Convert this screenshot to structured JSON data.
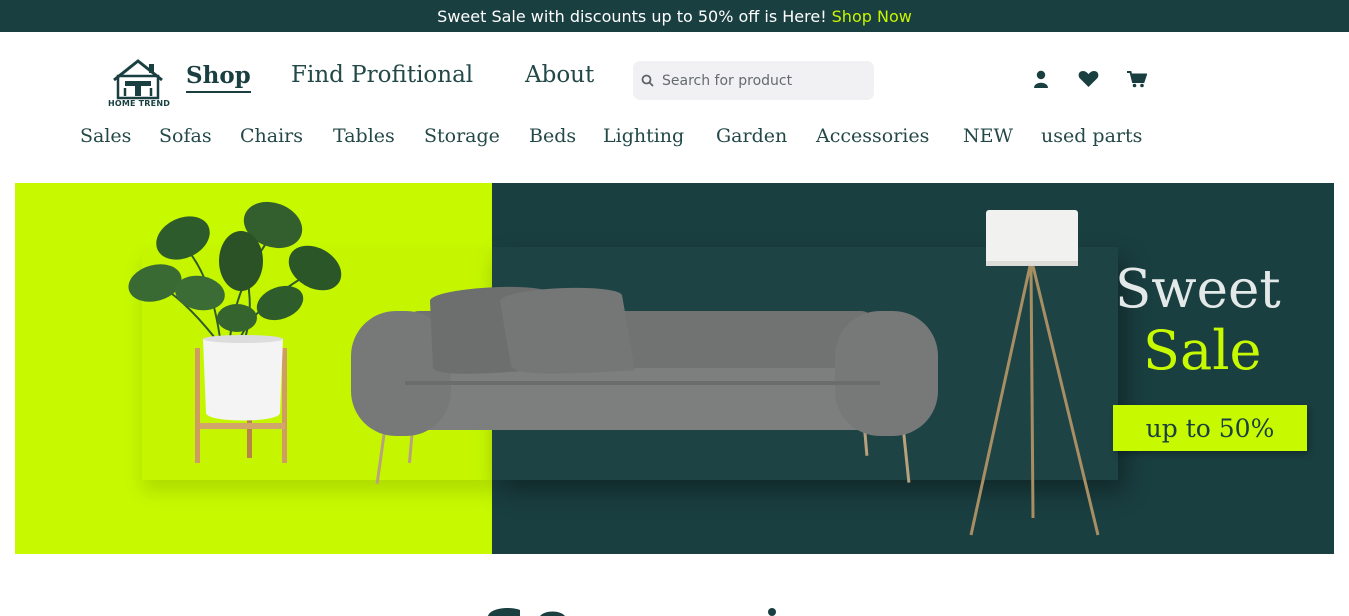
{
  "announcement": {
    "text": "Sweet Sale with discounts up to 50% off is Here!",
    "cta": "Shop Now"
  },
  "brand": {
    "logo_text": "HOME TREND"
  },
  "nav": {
    "main": [
      "Shop",
      "Find Profitional",
      "About"
    ],
    "active": "Shop"
  },
  "search": {
    "placeholder": "Search for product"
  },
  "header_icons": [
    "user-icon",
    "heart-icon",
    "cart-icon"
  ],
  "categories": [
    "Sales",
    "Sofas",
    "Chairs",
    "Tables",
    "Storage",
    "Beds",
    "Lighting",
    "Garden",
    "Accessories",
    "NEW",
    "used parts"
  ],
  "hero": {
    "title_line1": "Sweet",
    "title_line2": "Sale",
    "badge": "up to 50%"
  },
  "colors": {
    "dark_teal": "#1a3f41",
    "lime": "#c7fa00",
    "text": "#244848"
  }
}
